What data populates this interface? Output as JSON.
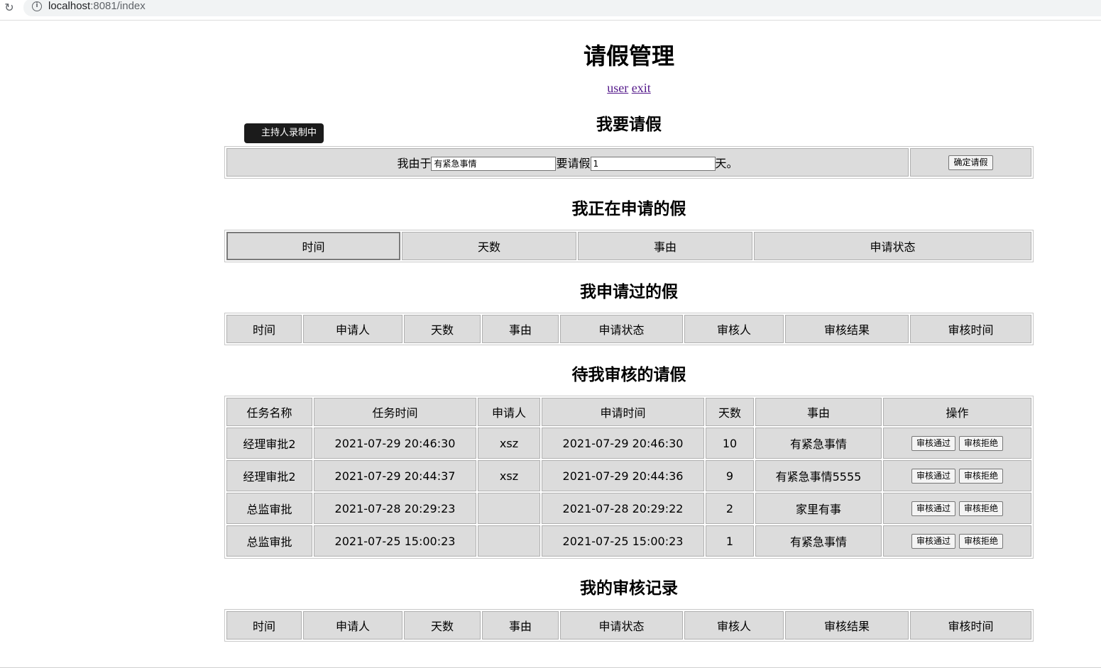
{
  "browser": {
    "url_host": "localhost",
    "url_rest": ":8081/index"
  },
  "title": "请假管理",
  "nav": {
    "user": "user",
    "exit": "exit"
  },
  "recording_badge": "主持人录制中",
  "apply": {
    "heading": "我要请假",
    "reason_prefix": "我由于",
    "reason_value": "有紧急事情",
    "days_prefix": "要请假",
    "days_value": "1",
    "days_suffix": "天。",
    "submit_label": "确定请假"
  },
  "pending": {
    "heading": "我正在申请的假",
    "columns": [
      "时间",
      "天数",
      "事由",
      "申请状态"
    ]
  },
  "history": {
    "heading": "我申请过的假",
    "columns": [
      "时间",
      "申请人",
      "天数",
      "事由",
      "申请状态",
      "审核人",
      "审核结果",
      "审核时间"
    ]
  },
  "tasks": {
    "heading": "待我审核的请假",
    "columns": [
      "任务名称",
      "任务时间",
      "申请人",
      "申请时间",
      "天数",
      "事由",
      "操作"
    ],
    "approve_label": "审核通过",
    "reject_label": "审核拒绝",
    "rows": [
      {
        "name": "经理审批2",
        "task_time": "2021-07-29 20:46:30",
        "applicant": "xsz",
        "apply_time": "2021-07-29 20:46:30",
        "days": "10",
        "reason": "有紧急事情"
      },
      {
        "name": "经理审批2",
        "task_time": "2021-07-29 20:44:37",
        "applicant": "xsz",
        "apply_time": "2021-07-29 20:44:36",
        "days": "9",
        "reason": "有紧急事情5555"
      },
      {
        "name": "总监审批",
        "task_time": "2021-07-28 20:29:23",
        "applicant": "",
        "apply_time": "2021-07-28 20:29:22",
        "days": "2",
        "reason": "家里有事"
      },
      {
        "name": "总监审批",
        "task_time": "2021-07-25 15:00:23",
        "applicant": "",
        "apply_time": "2021-07-25 15:00:23",
        "days": "1",
        "reason": "有紧急事情"
      }
    ]
  },
  "records": {
    "heading": "我的审核记录",
    "columns": [
      "时间",
      "申请人",
      "天数",
      "事由",
      "申请状态",
      "审核人",
      "审核结果",
      "审核时间"
    ]
  }
}
